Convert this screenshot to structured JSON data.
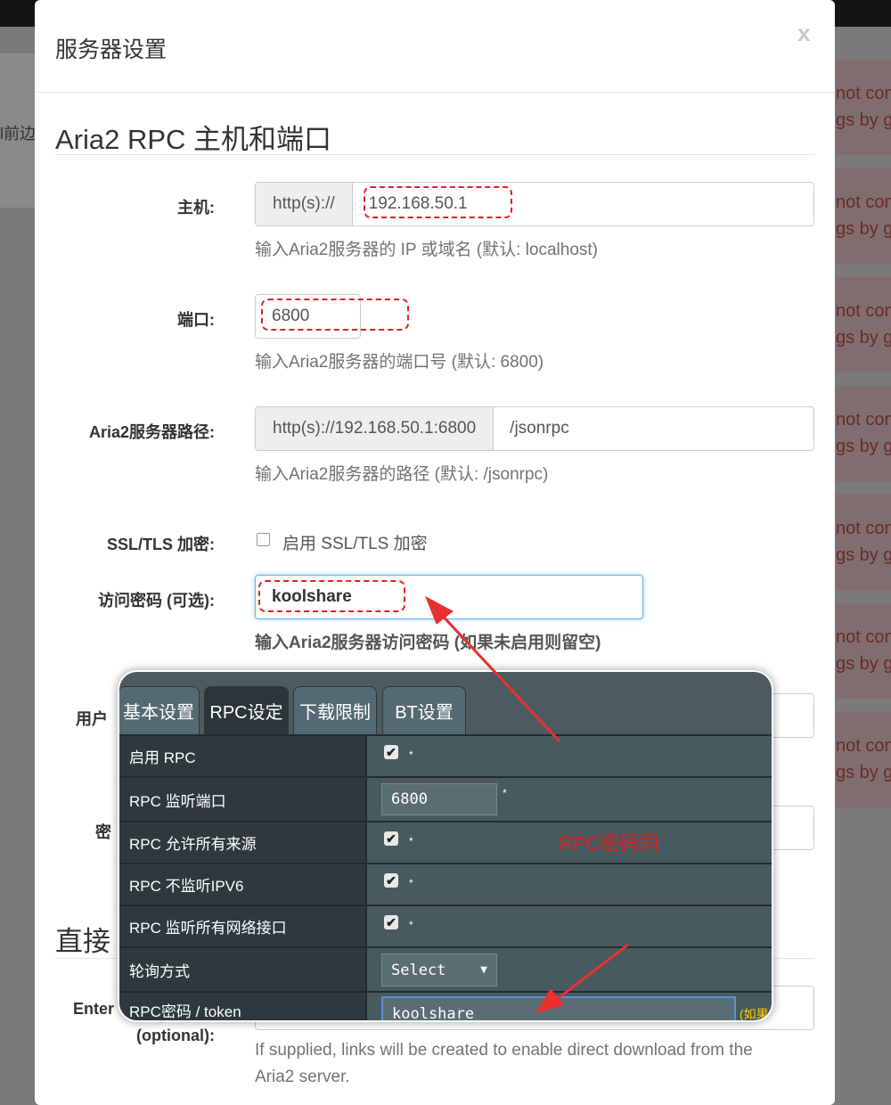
{
  "background": {
    "left_text": "l前边",
    "alert_line1": "not con",
    "alert_line2": "gs by go",
    "alert_count": 7
  },
  "modal": {
    "title": "服务器设置",
    "close_label": "x"
  },
  "section1": {
    "title": "Aria2 RPC 主机和端口"
  },
  "host": {
    "label": "主机:",
    "prefix": "http(s)://",
    "value": "192.168.50.1",
    "help": "输入Aria2服务器的 IP 或域名 (默认: localhost)"
  },
  "port": {
    "label": "端口:",
    "value": "6800",
    "help": "输入Aria2服务器的端口号 (默认: 6800)"
  },
  "path": {
    "label": "Aria2服务器路径:",
    "prefix": "http(s)://192.168.50.1:6800",
    "value": "/jsonrpc",
    "help": "输入Aria2服务器的路径 (默认: /jsonrpc)"
  },
  "ssl": {
    "label": "SSL/TLS 加密:",
    "checkbox_label": "启用 SSL/TLS 加密",
    "checked": false
  },
  "secret": {
    "label": "访问密码 (可选):",
    "value": "koolshare",
    "help": "输入Aria2服务器访问密码 (如果未启用则留空)"
  },
  "user": {
    "label": "用户"
  },
  "password2": {
    "label": "密"
  },
  "section2": {
    "title": "直接"
  },
  "direct": {
    "label1": "Enter",
    "label2": "(optional):",
    "help1": "If supplied, links will be created to enable direct download from the",
    "help2": "Aria2 server."
  },
  "popup": {
    "tabs": [
      {
        "label": "基本设置"
      },
      {
        "label": "RPC设定",
        "active": true
      },
      {
        "label": "下载限制"
      },
      {
        "label": "BT设置"
      }
    ],
    "rows": [
      {
        "label": "启用 RPC",
        "type": "checkbox",
        "checked": true
      },
      {
        "label": "RPC 监听端口",
        "type": "input",
        "value": "6800"
      },
      {
        "label": "RPC 允许所有来源",
        "type": "checkbox",
        "checked": true
      },
      {
        "label": "RPC 不监听IPV6",
        "type": "checkbox",
        "checked": true
      },
      {
        "label": "RPC 监听所有网络接口",
        "type": "checkbox",
        "checked": true
      },
      {
        "label": "轮询方式",
        "type": "select",
        "value": "Select"
      },
      {
        "label": "RPC密码 / token",
        "type": "input",
        "value": "koolshare",
        "hint": "(如果"
      }
    ],
    "star": "*",
    "annotation": "RPC密码同"
  },
  "colors": {
    "annotation": "#e02020",
    "focus": "#66afe9",
    "hint": "#ffcc00"
  }
}
